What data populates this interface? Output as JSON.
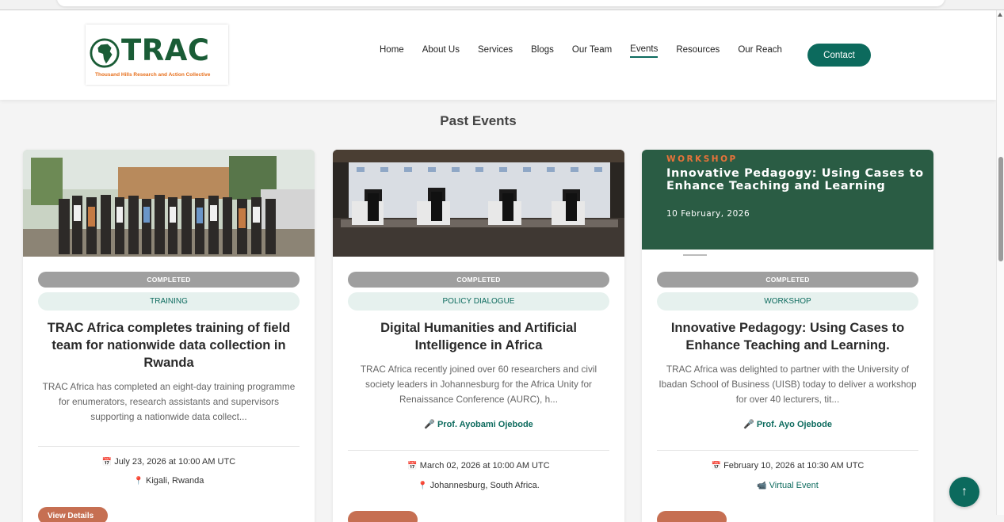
{
  "brand": {
    "logo_text": "TRAC",
    "tagline": "Thousand Hills Research and Action Collective",
    "primary": "#0c6a5d",
    "accent": "#e76f1b"
  },
  "nav": {
    "items": [
      "Home",
      "About Us",
      "Services",
      "Blogs",
      "Our Team",
      "Events",
      "Resources",
      "Our Reach"
    ],
    "active": "Events",
    "contact_label": "Contact"
  },
  "section": {
    "title": "Past Events"
  },
  "cards": [
    {
      "status": "COMPLETED",
      "category": "TRAINING",
      "title": "TRAC Africa completes training of field team for nationwide data collection in Rwanda",
      "description": "TRAC Africa has completed an eight-day training programme for enumerators, research assistants and supervisors supporting a nationwide data collect...",
      "date": "July 23, 2026 at 10:00 AM UTC",
      "location": "Kigali, Rwanda",
      "button": "View Details",
      "image": "group-photo"
    },
    {
      "status": "COMPLETED",
      "category": "POLICY DIALOGUE",
      "title": "Digital Humanities and Artificial Intelligence in Africa",
      "description": "TRAC Africa recently joined over 60 researchers and civil society leaders in Johannesburg for the Africa Unity for Renaissance Conference (AURC), h...",
      "speaker": "Prof. Ayobami Ojebode",
      "date": "March 02, 2026 at 10:00 AM UTC",
      "location": "Johannesburg, South Africa.",
      "image": "panel-photo"
    },
    {
      "status": "COMPLETED",
      "category": "WORKSHOP",
      "title": "Innovative Pedagogy: Using Cases to Enhance Teaching and Learning.",
      "description": "TRAC Africa was delighted to partner with the University of Ibadan School of Business (UISB) today to deliver a workshop for over 40 lecturers, tit...",
      "speaker": "Prof. Ayo Ojebode",
      "date": "February 10, 2026 at 10:30 AM UTC",
      "location": "Virtual Event",
      "banner": {
        "kicker": "WORKSHOP",
        "title": "Innovative Pedagogy: Using Cases to Enhance Teaching and Learning",
        "date": "10 February, 2026"
      }
    }
  ],
  "icons": {
    "speaker": "🎤",
    "calendar": "📅",
    "pin": "📍",
    "video": "📹",
    "back_to_top": "↑"
  }
}
